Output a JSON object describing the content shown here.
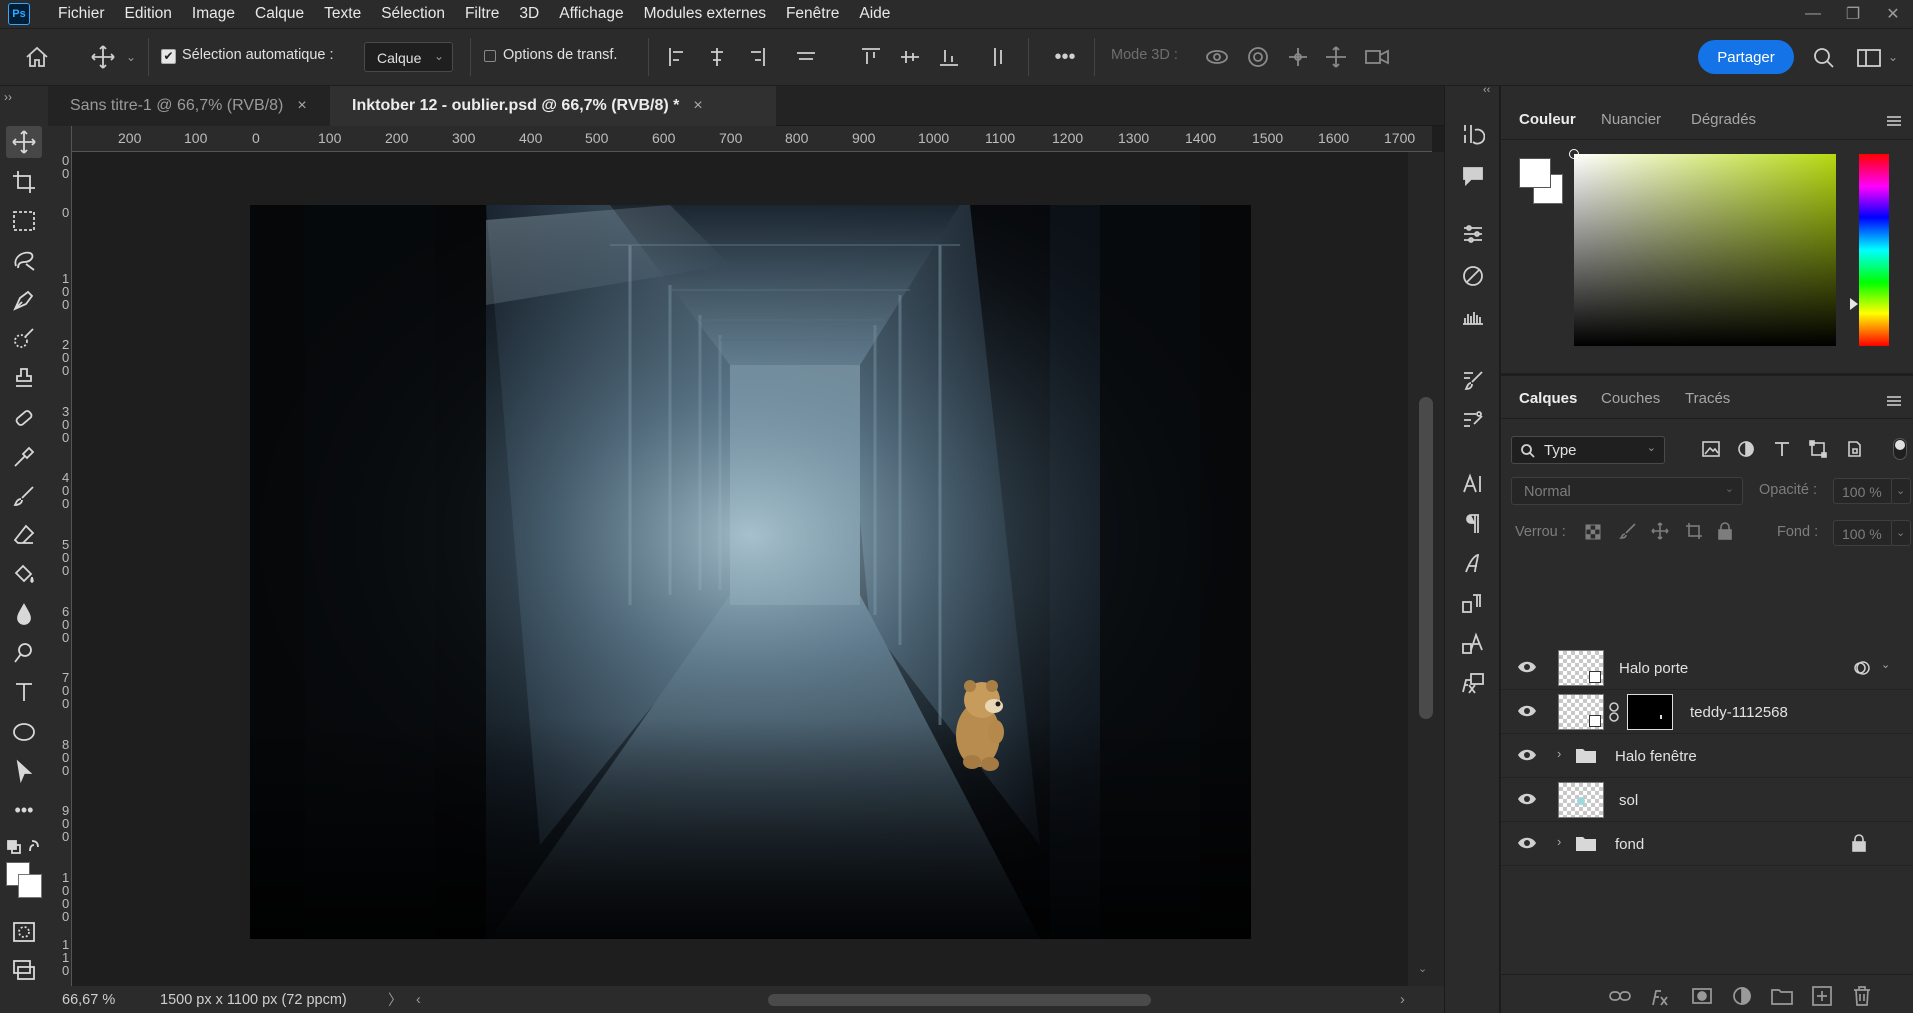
{
  "app": {
    "logo": "Ps"
  },
  "menu": [
    "Fichier",
    "Edition",
    "Image",
    "Calque",
    "Texte",
    "Sélection",
    "Filtre",
    "3D",
    "Affichage",
    "Modules externes",
    "Fenêtre",
    "Aide"
  ],
  "window_controls": {
    "minimize": "—",
    "restore": "❐",
    "close": "✕"
  },
  "options_bar": {
    "auto_select_label": "Sélection automatique :",
    "auto_select_checked": true,
    "auto_select_check": "✔",
    "target_value": "Calque",
    "transform_label": "Options de transf.",
    "more": "•••",
    "mode3d_label": "Mode 3D :",
    "share_label": "Partager",
    "dropdown_chevron": "⌄"
  },
  "tabs": [
    {
      "label": "Sans titre-1 @ 66,7% (RVB/8)",
      "active": false
    },
    {
      "label": "Inktober 12 - oublier.psd @ 66,7% (RVB/8) *",
      "active": true
    }
  ],
  "tab_close": "×",
  "panel_collapse": "‹‹",
  "toolbar_expand": "››",
  "ruler_top_labels": [
    "200",
    "100",
    "0",
    "100",
    "200",
    "300",
    "400",
    "500",
    "600",
    "700",
    "800",
    "900",
    "1000",
    "1100",
    "1200",
    "1300",
    "1400",
    "1500",
    "1600",
    "1700"
  ],
  "ruler_left_labels": [
    [
      "0",
      "0"
    ],
    [
      "0"
    ],
    [
      "1",
      "0",
      "0"
    ],
    [
      "2",
      "0",
      "0"
    ],
    [
      "3",
      "0",
      "0"
    ],
    [
      "4",
      "0",
      "0"
    ],
    [
      "5",
      "0",
      "0"
    ],
    [
      "6",
      "0",
      "0"
    ],
    [
      "7",
      "0",
      "0"
    ],
    [
      "8",
      "0",
      "0"
    ],
    [
      "9",
      "0",
      "0"
    ],
    [
      "1",
      "0",
      "0",
      "0"
    ],
    [
      "1",
      "1",
      "0"
    ]
  ],
  "status": {
    "zoom": "66,67 %",
    "doc_size": "1500 px x 1100 px (72 ppcm)",
    "arrow_right": "〉",
    "arrow_left": "‹",
    "arrow_right_end": "›"
  },
  "color_panel": {
    "tabs": [
      "Couleur",
      "Nuancier",
      "Dégradés"
    ],
    "fg": "#ffffff",
    "bg": "#ffffff",
    "hue": "#b6d911"
  },
  "layers_panel": {
    "tabs": [
      "Calques",
      "Couches",
      "Tracés"
    ],
    "filter_kind": "Type",
    "blend_mode": "Normal",
    "opacity_label": "Opacité :",
    "opacity_value": "100 %",
    "lock_label": "Verrou :",
    "fill_label": "Fond :",
    "fill_value": "100 %",
    "layers": [
      {
        "name": "Halo porte",
        "type": "smart-object",
        "visible": true
      },
      {
        "name": "teddy-1112568",
        "type": "smart-object-with-mask",
        "visible": true
      },
      {
        "name": "Halo fenêtre",
        "type": "group",
        "visible": true
      },
      {
        "name": "sol",
        "type": "pixel",
        "visible": true
      },
      {
        "name": "fond",
        "type": "group",
        "visible": true,
        "locked": true
      }
    ]
  }
}
